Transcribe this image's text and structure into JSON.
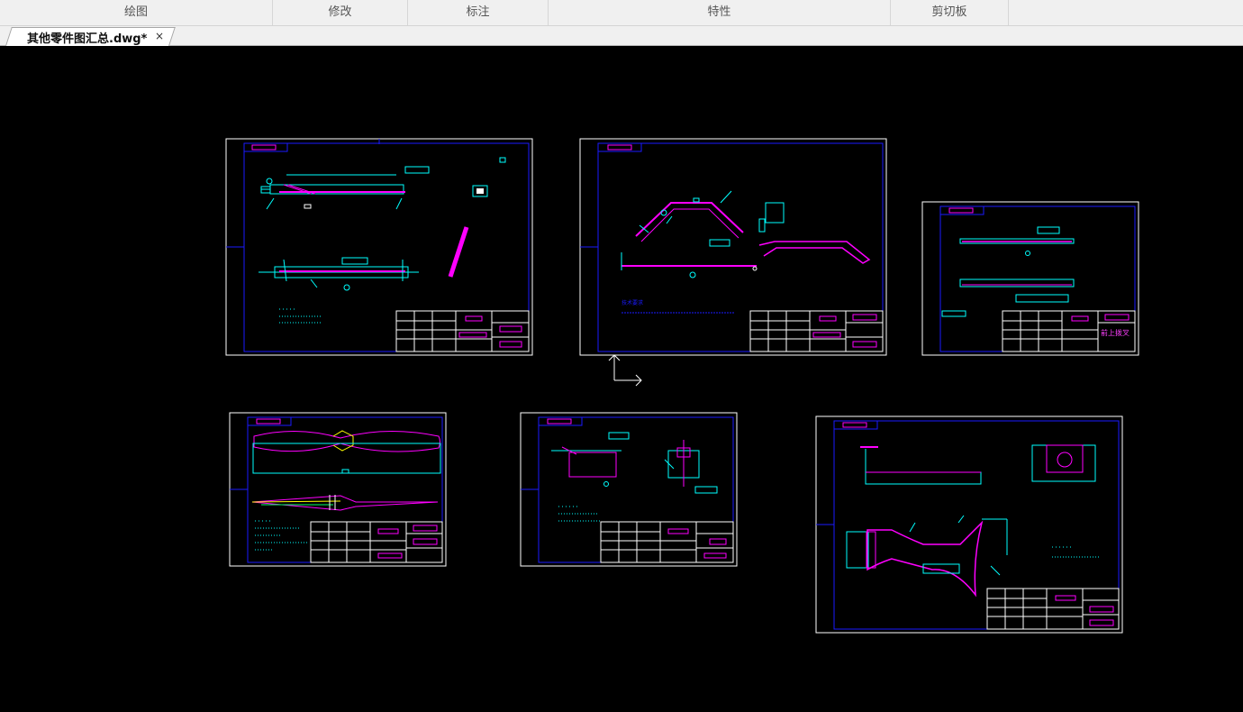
{
  "ribbon": {
    "groups": [
      "绘图",
      "修改",
      "标注",
      "特性",
      "剪切板"
    ]
  },
  "document_tab": {
    "title": "其他零件图汇总.dwg*",
    "close_glyph": "×"
  },
  "colors": {
    "background": "#000000",
    "sheet_border": "#ffffff",
    "inner_frame": "#1a1aff",
    "cyan": "#00ffff",
    "magenta": "#ff00ff",
    "yellow": "#ffff00",
    "title_block_text": "#ff40ff"
  },
  "drawing_annotations": {
    "tech_req_3": "技术要求",
    "title_block_text_3": "前上拨叉"
  }
}
